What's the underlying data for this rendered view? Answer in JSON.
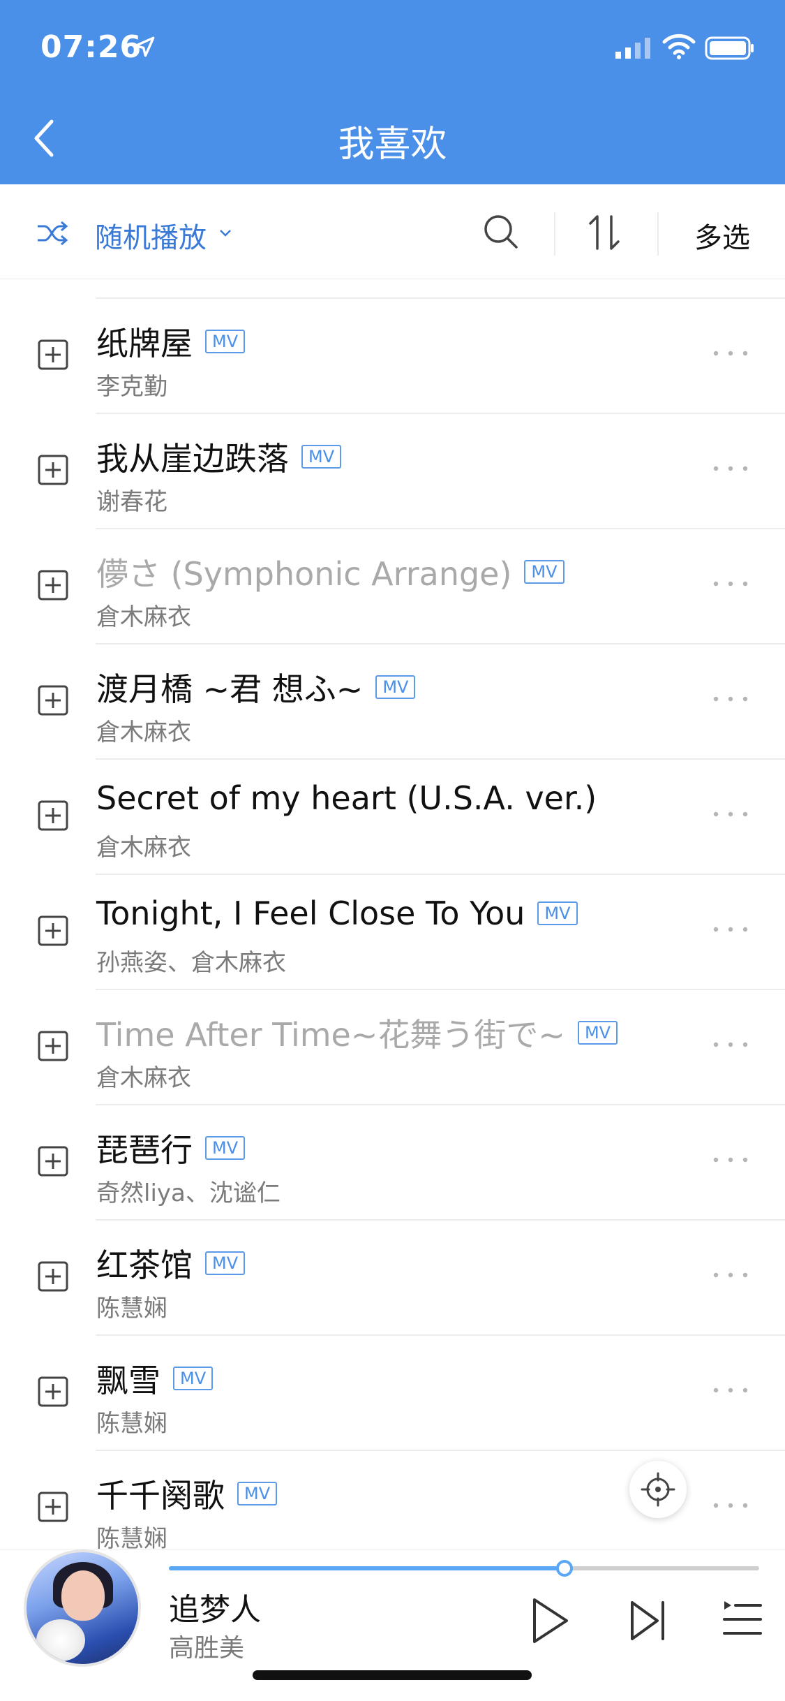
{
  "status": {
    "time": "07:26"
  },
  "header": {
    "title": "我喜欢"
  },
  "toolbar": {
    "shuffle_label": "随机播放",
    "multi_select_label": "多选"
  },
  "songs": [
    {
      "title": "纸牌屋",
      "artist": "李克勤",
      "mv": "MV",
      "dim": false
    },
    {
      "title": "我从崖边跌落",
      "artist": "谢春花",
      "mv": "MV",
      "dim": false
    },
    {
      "title": "儚さ (Symphonic Arrange)",
      "artist": "倉木麻衣",
      "mv": "MV",
      "dim": true
    },
    {
      "title": "渡月橋 ~君 想ふ~",
      "artist": "倉木麻衣",
      "mv": "MV",
      "dim": false
    },
    {
      "title": "Secret of my heart (U.S.A. ver.)",
      "artist": "倉木麻衣",
      "mv": "",
      "dim": false
    },
    {
      "title": "Tonight, I Feel Close To You",
      "artist": "孙燕姿、倉木麻衣",
      "mv": "MV",
      "dim": false
    },
    {
      "title": "Time After Time~花舞う街で~",
      "artist": "倉木麻衣",
      "mv": "MV",
      "dim": true
    },
    {
      "title": "琵琶行",
      "artist": "奇然liya、沈谧仁",
      "mv": "MV",
      "dim": false
    },
    {
      "title": "红茶馆",
      "artist": "陈慧娴",
      "mv": "MV",
      "dim": false
    },
    {
      "title": "飘雪",
      "artist": "陈慧娴",
      "mv": "MV",
      "dim": false
    },
    {
      "title": "千千阕歌",
      "artist": "陈慧娴",
      "mv": "MV",
      "dim": false
    }
  ],
  "now_playing": {
    "title": "追梦人",
    "artist": "高胜美",
    "progress": 0.67
  },
  "colors": {
    "accent": "#4a8fe8",
    "dim_text": "#a9a9a9",
    "secondary_text": "#7b7b7b"
  },
  "icons": [
    "location-arrow-icon",
    "signal-icon",
    "wifi-icon",
    "battery-icon",
    "back-icon",
    "shuffle-icon",
    "chevron-down-icon",
    "search-icon",
    "sort-icon",
    "add-icon",
    "more-icon",
    "locate-icon",
    "play-icon",
    "next-icon",
    "queue-icon"
  ]
}
